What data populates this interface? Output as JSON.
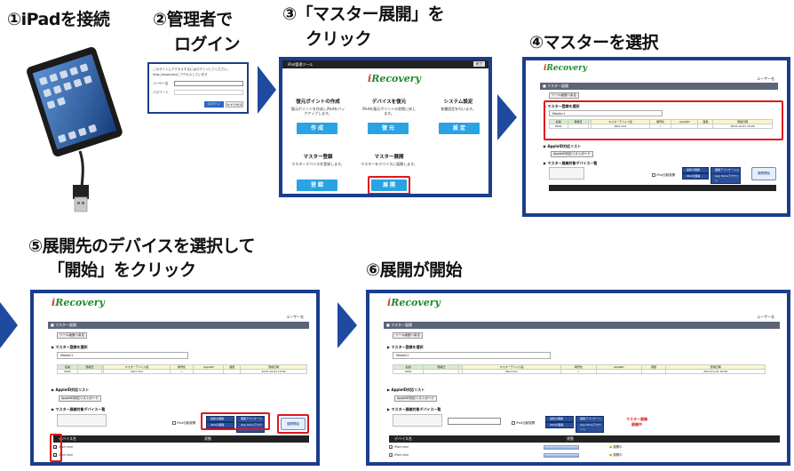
{
  "steps": {
    "s1": "①iPadを接続",
    "s2_line1": "②管理者で",
    "s2_line2": "ログイン",
    "s3_line1": "③「マスター展開」を",
    "s3_line2": "クリック",
    "s4": "④マスターを選択",
    "s5_line1": "⑤展開先のデバイスを選択して",
    "s5_line2": "「開始」をクリック",
    "s6": "⑥展開が開始"
  },
  "colors": {
    "panel_border": "#1a3e8c",
    "arrow": "#1e4aa0",
    "highlight": "#e0161e",
    "menu_button": "#2aa3e4"
  },
  "login": {
    "line1": "このサイトにアクセスするにはログインしてください。",
    "line2": "http://example/にアクセスしています",
    "user_label": "ユーザー名",
    "pass_label": "パスワード",
    "login_btn": "ログイン",
    "cancel_btn": "キャンセル"
  },
  "menu": {
    "title": "iPad管理ツール",
    "badge": "終了",
    "logo": "Recovery",
    "restore_title": "復元ポイントの作成",
    "restore_desc": "復元ポイントを作成しiPadをバックアップします。",
    "restore_btn": "作 成",
    "device_title": "デバイスを復元",
    "device_desc": "iPadを復元ポイントの状態に戻します。",
    "device_btn": "復 元",
    "system_title": "システム設定",
    "system_desc": "各種設定を行います。",
    "system_btn": "設 定",
    "master_reg_title": "マスター登録",
    "master_reg_desc": "マスターデバイスを登録します。",
    "master_reg_btn": "登 録",
    "master_dep_title": "マスター展開",
    "master_dep_desc": "マスターをデバイスに展開します。",
    "master_dep_btn": "展 開"
  },
  "deploy": {
    "logo": "Recovery",
    "user": "ユーザー名",
    "header": "マスター展開",
    "back_btn": "ツール画面へ戻る",
    "select_label": "マスター登録を選択",
    "select_value": "Master1",
    "col_id": "名前",
    "col_date": "登録日",
    "col_master": "マスターデバイス名",
    "col_backup": "暗号化",
    "col_appid": "AppleID",
    "col_size": "容量",
    "col_time": "登録日時",
    "row_id": "0001",
    "row_master": "iPad mini",
    "row_time": "2013-12-01 10:00",
    "applist_label": "AppleID対応リスト",
    "applist_btn": "AppleID対応リストボード",
    "devices_label": "マスター展開対象デバイス一覧",
    "filter1": "最新の展開",
    "filter2": "展開アプリケーション",
    "filter3": "iPadの展開",
    "filter4": "App Storeアカウント",
    "auto_check": "iPad自動展開",
    "start_btn": "展開開始",
    "dev_col_name": "デバイス名",
    "dev_col_status": "状態",
    "dev_row1": "iPad mini",
    "dev_row2": "iPad mini",
    "progress_label": "マスター展開",
    "progress_sub": "展開中",
    "status1": "展開中",
    "status2": "展開中"
  }
}
